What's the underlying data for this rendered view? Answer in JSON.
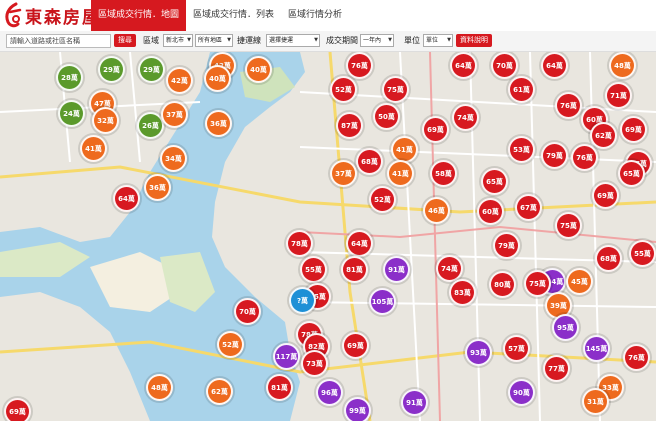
{
  "brand": {
    "name": "東森房屋"
  },
  "tabs": [
    "區域成交行情．地圖",
    "區域成交行情．列表",
    "區域行情分析"
  ],
  "filters": {
    "search_placeholder": "請輸入道路或社區名稱",
    "search_button": "搜尋",
    "region_label": "區域",
    "city": "新北市",
    "district": "所有地區",
    "mrt_label": "捷運線",
    "mrt_value": "選擇捷運",
    "period_label": "成交期間",
    "period_value": "一年內",
    "unit_label": "單位",
    "unit_value": "單位",
    "info_button": "資料說明"
  },
  "colors": {
    "red": "#d71920",
    "orange": "#ee6a1e",
    "green": "#5b9a2b",
    "purple": "#8b2fc9",
    "blue": "#1e90d6",
    "brand": "#d6191f"
  },
  "markers": [
    {
      "label": "29萬",
      "color": "green"
    },
    {
      "label": "29萬",
      "color": "green"
    },
    {
      "label": "28萬",
      "color": "green"
    },
    {
      "label": "24萬",
      "color": "green"
    },
    {
      "label": "26萬",
      "color": "green"
    },
    {
      "label": "42萬",
      "color": "orange"
    },
    {
      "label": "42萬",
      "color": "orange"
    },
    {
      "label": "40萬",
      "color": "orange"
    },
    {
      "label": "47萬",
      "color": "orange"
    },
    {
      "label": "40萬",
      "color": "orange"
    },
    {
      "label": "37萬",
      "color": "orange"
    },
    {
      "label": "32萬",
      "color": "orange"
    },
    {
      "label": "36萬",
      "color": "orange"
    },
    {
      "label": "41萬",
      "color": "orange"
    },
    {
      "label": "34萬",
      "color": "orange"
    },
    {
      "label": "36萬",
      "color": "orange"
    },
    {
      "label": "64萬",
      "color": "red"
    },
    {
      "label": "76萬",
      "color": "red"
    },
    {
      "label": "64萬",
      "color": "red"
    },
    {
      "label": "70萬",
      "color": "red"
    },
    {
      "label": "64萬",
      "color": "red"
    },
    {
      "label": "48萬",
      "color": "orange"
    },
    {
      "label": "52萬",
      "color": "red"
    },
    {
      "label": "75萬",
      "color": "red"
    },
    {
      "label": "61萬",
      "color": "red"
    },
    {
      "label": "76萬",
      "color": "red"
    },
    {
      "label": "71萬",
      "color": "red"
    },
    {
      "label": "87萬",
      "color": "red"
    },
    {
      "label": "50萬",
      "color": "red"
    },
    {
      "label": "69萬",
      "color": "red"
    },
    {
      "label": "74萬",
      "color": "red"
    },
    {
      "label": "60萬",
      "color": "red"
    },
    {
      "label": "69萬",
      "color": "red"
    },
    {
      "label": "53萬",
      "color": "red"
    },
    {
      "label": "62萬",
      "color": "red"
    },
    {
      "label": "41萬",
      "color": "orange"
    },
    {
      "label": "68萬",
      "color": "red"
    },
    {
      "label": "41萬",
      "color": "orange"
    },
    {
      "label": "58萬",
      "color": "red"
    },
    {
      "label": "79萬",
      "color": "red"
    },
    {
      "label": "76萬",
      "color": "red"
    },
    {
      "label": "67萬",
      "color": "red"
    },
    {
      "label": "37萬",
      "color": "orange"
    },
    {
      "label": "65萬",
      "color": "red"
    },
    {
      "label": "69萬",
      "color": "red"
    },
    {
      "label": "65萬",
      "color": "red"
    },
    {
      "label": "52萬",
      "color": "red"
    },
    {
      "label": "46萬",
      "color": "orange"
    },
    {
      "label": "60萬",
      "color": "red"
    },
    {
      "label": "67萬",
      "color": "red"
    },
    {
      "label": "75萬",
      "color": "red"
    },
    {
      "label": "78萬",
      "color": "red"
    },
    {
      "label": "64萬",
      "color": "red"
    },
    {
      "label": "55萬",
      "color": "red"
    },
    {
      "label": "79萬",
      "color": "red"
    },
    {
      "label": "68萬",
      "color": "red"
    },
    {
      "label": "55萬",
      "color": "red"
    },
    {
      "label": "65萬",
      "color": "red"
    },
    {
      "label": "81萬",
      "color": "red"
    },
    {
      "label": "91萬",
      "color": "purple"
    },
    {
      "label": "74萬",
      "color": "red"
    },
    {
      "label": "134萬",
      "color": "purple"
    },
    {
      "label": "75萬",
      "color": "red"
    },
    {
      "label": "45萬",
      "color": "orange"
    },
    {
      "label": "?萬",
      "color": "blue"
    },
    {
      "label": "105萬",
      "color": "purple"
    },
    {
      "label": "83萬",
      "color": "red"
    },
    {
      "label": "80萬",
      "color": "red"
    },
    {
      "label": "39萬",
      "color": "orange"
    },
    {
      "label": "70萬",
      "color": "red"
    },
    {
      "label": "78萬",
      "color": "red"
    },
    {
      "label": "95萬",
      "color": "purple"
    },
    {
      "label": "52萬",
      "color": "orange"
    },
    {
      "label": "69萬",
      "color": "red"
    },
    {
      "label": "82萬",
      "color": "red"
    },
    {
      "label": "93萬",
      "color": "purple"
    },
    {
      "label": "57萬",
      "color": "red"
    },
    {
      "label": "145萬",
      "color": "purple"
    },
    {
      "label": "76萬",
      "color": "red"
    },
    {
      "label": "117萬",
      "color": "purple"
    },
    {
      "label": "73萬",
      "color": "red"
    },
    {
      "label": "77萬",
      "color": "red"
    },
    {
      "label": "33萬",
      "color": "orange"
    },
    {
      "label": "48萬",
      "color": "orange"
    },
    {
      "label": "62萬",
      "color": "orange"
    },
    {
      "label": "81萬",
      "color": "red"
    },
    {
      "label": "96萬",
      "color": "purple"
    },
    {
      "label": "90萬",
      "color": "purple"
    },
    {
      "label": "31萬",
      "color": "orange"
    },
    {
      "label": "69萬",
      "color": "red"
    },
    {
      "label": "99萬",
      "color": "purple"
    },
    {
      "label": "91萬",
      "color": "purple"
    }
  ]
}
